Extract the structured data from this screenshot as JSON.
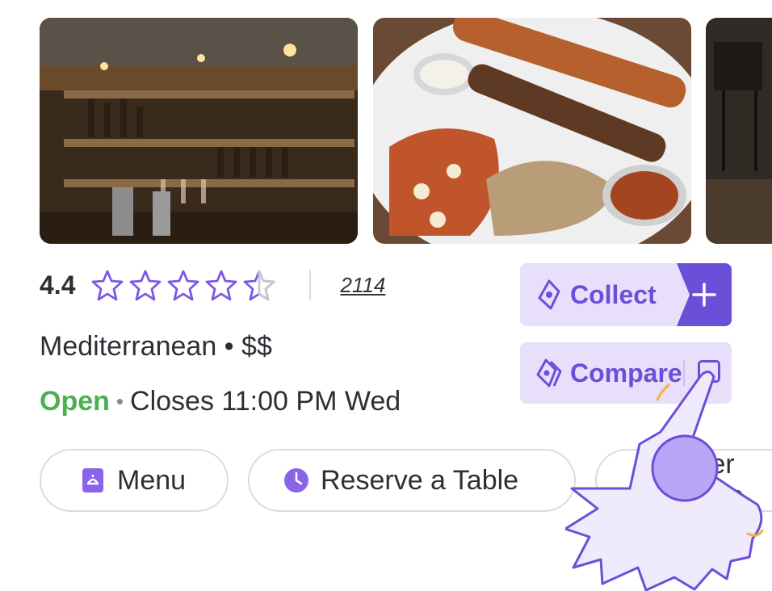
{
  "photos": [
    {
      "alt": "bar interior"
    },
    {
      "alt": "kebab platter"
    },
    {
      "alt": "dining room"
    }
  ],
  "rating": {
    "value": "4.4",
    "stars": 4.5,
    "max_stars": 5,
    "review_count": "2114"
  },
  "cuisine": "Mediterranean • $$",
  "hours": {
    "status": "Open",
    "separator": "•",
    "text": "Closes 11:00 PM Wed"
  },
  "actions": {
    "collect_label": "Collect",
    "compare_label": "Compare"
  },
  "pills": [
    {
      "label": "Menu",
      "icon": "menu-book-icon"
    },
    {
      "label": "Reserve a Table",
      "icon": "clock-icon"
    },
    {
      "label": "Order Online",
      "icon": "bag-icon"
    }
  ],
  "colors": {
    "accent": "#6b4fd8",
    "accent_light": "#e8e0fb",
    "open_green": "#4caf50",
    "star": "#7b57e6"
  }
}
